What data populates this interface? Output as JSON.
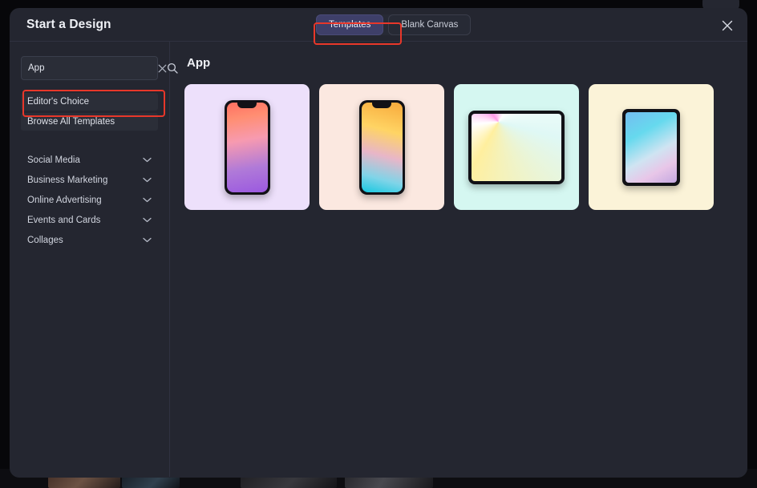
{
  "window": {
    "title": "Start a Design",
    "close_icon": "close-icon"
  },
  "tabs": [
    {
      "label": "Templates",
      "active": true
    },
    {
      "label": "Blank Canvas",
      "active": false
    }
  ],
  "sidebar": {
    "search": {
      "value": "App",
      "placeholder": "Search templates",
      "clear_icon": "close-icon",
      "search_icon": "search-icon"
    },
    "quick_links": [
      {
        "label": "Editor's Choice"
      },
      {
        "label": "Browse All Templates"
      }
    ],
    "categories": [
      {
        "label": "Social Media",
        "icon": "chevron-down-icon"
      },
      {
        "label": "Business Marketing",
        "icon": "chevron-down-icon"
      },
      {
        "label": "Online Advertising",
        "icon": "chevron-down-icon"
      },
      {
        "label": "Events and Cards",
        "icon": "chevron-down-icon"
      },
      {
        "label": "Collages",
        "icon": "chevron-down-icon"
      }
    ]
  },
  "main": {
    "heading": "App",
    "templates": [
      {
        "device": "phone",
        "card_color": "#ede0fb"
      },
      {
        "device": "phone",
        "card_color": "#fbe8e0"
      },
      {
        "device": "tablet-land",
        "card_color": "#d5f7f1"
      },
      {
        "device": "tablet-port",
        "card_color": "#fbf3d8"
      }
    ]
  },
  "annotations": {
    "color": "#e8372a",
    "targets": [
      "templates-tab",
      "search-input"
    ]
  }
}
